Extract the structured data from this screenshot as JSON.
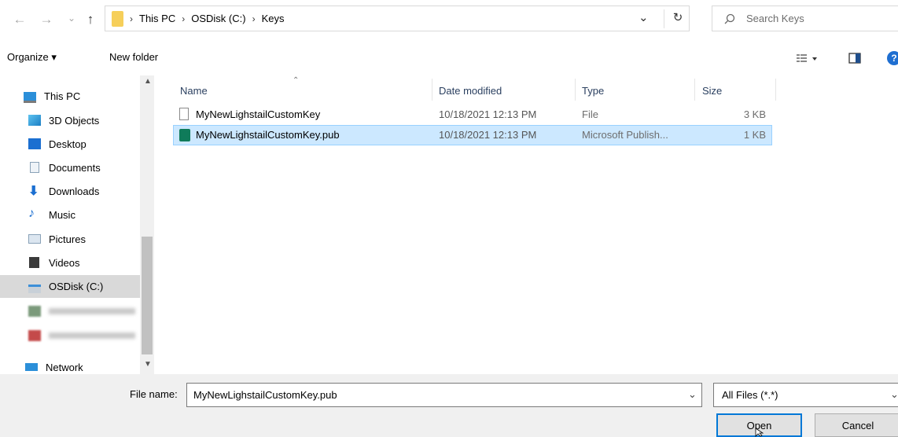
{
  "nav_buttons": {
    "back": "←",
    "forward": "→",
    "recent": "⌄",
    "up": "↑"
  },
  "address": {
    "crumbs": [
      "This PC",
      "OSDisk (C:)",
      "Keys"
    ],
    "dropdown": "⌄",
    "refresh": "↻"
  },
  "search": {
    "placeholder": "Search Keys"
  },
  "toolbar": {
    "organize": "Organize ▾",
    "new_folder": "New folder",
    "help": "?"
  },
  "nav_pane": {
    "items": [
      {
        "label": "This PC",
        "icon": "pc-icon"
      },
      {
        "label": "3D Objects",
        "icon": "cube-icon"
      },
      {
        "label": "Desktop",
        "icon": "desktop-icon"
      },
      {
        "label": "Documents",
        "icon": "documents-icon"
      },
      {
        "label": "Downloads",
        "icon": "download-icon"
      },
      {
        "label": "Music",
        "icon": "music-icon"
      },
      {
        "label": "Pictures",
        "icon": "pictures-icon"
      },
      {
        "label": "Videos",
        "icon": "videos-icon"
      },
      {
        "label": "OSDisk (C:)",
        "icon": "drive-icon"
      },
      {
        "label": "",
        "icon": "blurred-drive-icon"
      },
      {
        "label": "",
        "icon": "blurred-drive-icon"
      },
      {
        "label": "Network",
        "icon": "network-icon"
      }
    ]
  },
  "columns": {
    "name": "Name",
    "date": "Date modified",
    "type": "Type",
    "size": "Size"
  },
  "files": [
    {
      "name": "MyNewLighstailCustomKey",
      "date": "10/18/2021 12:13 PM",
      "type": "File",
      "size": "3 KB",
      "icon": "file-icon"
    },
    {
      "name": "MyNewLighstailCustomKey.pub",
      "date": "10/18/2021 12:13 PM",
      "type": "Microsoft Publish...",
      "size": "1 KB",
      "icon": "publisher-file-icon"
    }
  ],
  "filename": {
    "label": "File name:",
    "value": "MyNewLighstailCustomKey.pub"
  },
  "filter": {
    "value": "All Files (*.*)"
  },
  "buttons": {
    "open": "Open",
    "cancel": "Cancel"
  },
  "colors": {
    "selection": "#cce8ff",
    "selection_border": "#99d1ff",
    "accent": "#0078d7"
  }
}
